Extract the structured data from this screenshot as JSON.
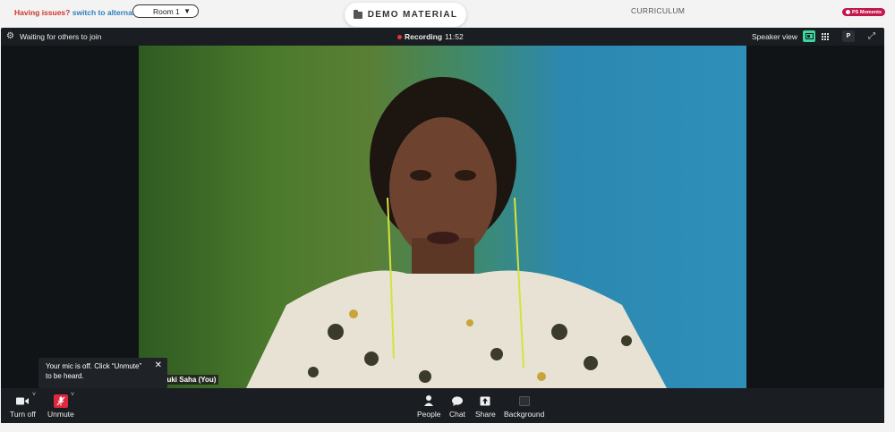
{
  "topbar": {
    "issues_prefix": "Having issues?",
    "issues_link": "switch to alternate room",
    "room": "Room 1",
    "demo_button": "DEMO MATERIAL",
    "curriculum": "CURRICULUM",
    "moments": "PS Moments"
  },
  "meeting": {
    "status": "Waiting for others to join",
    "recording_label": "Recording",
    "recording_time": "11:52",
    "view_label": "Speaker view",
    "p_button": "P"
  },
  "video": {
    "name_tag": "yuki Saha (You)"
  },
  "tooltip": {
    "line1": "Your mic is off. Click “Unmute”",
    "line2": "to be heard."
  },
  "toolbar": {
    "turn_off": "Turn off",
    "unmute": "Unmute",
    "people": "People",
    "chat": "Chat",
    "share": "Share",
    "background": "Background"
  },
  "colors": {
    "accent_green": "#3ed6a0",
    "mute_red": "#e0283c",
    "recording_red": "#e53935",
    "moments_pink": "#c2174b"
  }
}
